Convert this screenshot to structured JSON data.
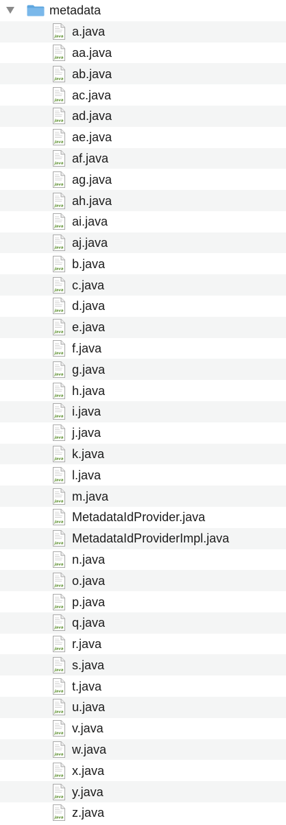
{
  "window": {
    "title": "metadata"
  },
  "tree": {
    "folder": {
      "name": "metadata",
      "expanded": true,
      "icon": "folder-icon",
      "disclosure_icon": "disclosure-triangle-down-icon"
    },
    "file_icon": "java-file-icon",
    "file_icon_text": "java",
    "files": [
      "a.java",
      "aa.java",
      "ab.java",
      "ac.java",
      "ad.java",
      "ae.java",
      "af.java",
      "ag.java",
      "ah.java",
      "ai.java",
      "aj.java",
      "b.java",
      "c.java",
      "d.java",
      "e.java",
      "f.java",
      "g.java",
      "h.java",
      "i.java",
      "j.java",
      "k.java",
      "l.java",
      "m.java",
      "MetadataIdProvider.java",
      "MetadataIdProviderImpl.java",
      "n.java",
      "o.java",
      "p.java",
      "q.java",
      "r.java",
      "s.java",
      "t.java",
      "u.java",
      "v.java",
      "w.java",
      "x.java",
      "y.java",
      "z.java"
    ]
  },
  "colors": {
    "stripe": "#f4f5f5",
    "folder": "#7ab8ea",
    "folder_dark": "#5ea6df",
    "text": "#1b1b1b",
    "disclosure": "#8a8a8a",
    "java_green": "#5b8f2d"
  }
}
